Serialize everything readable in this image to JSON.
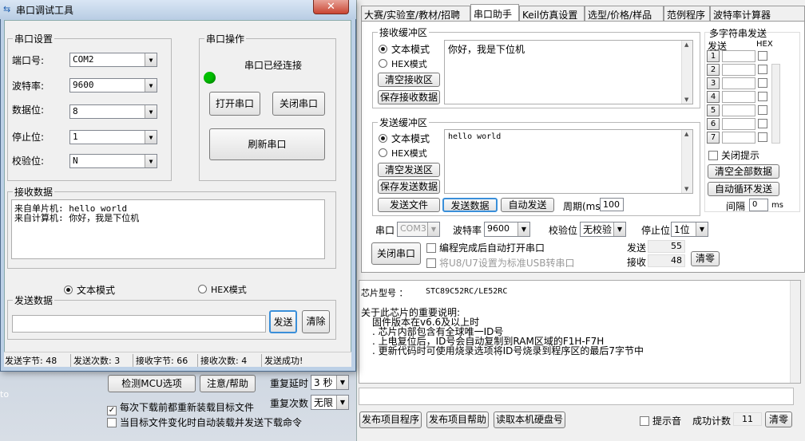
{
  "stc": {
    "tabs": [
      "大赛/实验室/教材/招聘",
      "串口助手",
      "Keil仿真设置",
      "选型/价格/样品",
      "范例程序",
      "波特率计算器"
    ],
    "recv_group": "接收缓冲区",
    "recv_text_mode": "文本模式",
    "recv_hex_mode": "HEX模式",
    "recv_clear": "清空接收区",
    "recv_save": "保存接收数据",
    "recv_content": "你好，我是下位机",
    "send_group": "发送缓冲区",
    "send_text_mode": "文本模式",
    "send_hex_mode": "HEX模式",
    "send_clear": "清空发送区",
    "send_save": "保存发送数据",
    "send_content": "hello world",
    "send_file": "发送文件",
    "send_data": "发送数据",
    "auto_send": "自动发送",
    "period_label": "周期(ms)",
    "period_value": "100",
    "multi_title": "多字符串发送",
    "multi_send": "发送",
    "multi_hex": "HEX",
    "multi_rows": [
      "1",
      "2",
      "3",
      "4",
      "5",
      "6",
      "7"
    ],
    "close_tip": "关闭提示",
    "clear_all": "清空全部数据",
    "auto_loop": "自动循环发送",
    "interval_label": "间隔",
    "interval_value": "0",
    "interval_unit": "ms",
    "port_label": "串口",
    "port_value": "COM3",
    "baud_label": "波特率",
    "baud_value": "9600",
    "parity_label": "校验位",
    "parity_value": "无校验",
    "stop_label": "停止位",
    "stop_value": "1位",
    "close_port": "关闭串口",
    "auto_open": "编程完成后自动打开串口",
    "usb_option": "将U8/U7设置为标准USB转串口",
    "sent_label": "发送",
    "sent_value": "55",
    "recv_label": "接收",
    "recv_value": "48",
    "clear_counts": "清零",
    "chip_label": "芯片型号 ：",
    "chip_value": "STC89C52RC/LE52RC",
    "info_title": "关于此芯片的重要说明:",
    "info_lines": [
      "固件版本在v6.6及以上时",
      "芯片内部包含有全球唯一ID号",
      "上电复位后，ID号会自动复制到RAM区域的F1H-F7H",
      "更新代码时可使用烧录选项将ID号烧录到程序区的最后7字节中"
    ],
    "detect_mcu": "检测MCU选项",
    "help": "注意/帮助",
    "delay_label": "重复延时",
    "delay_value": "3 秒",
    "count_label": "重复次数",
    "count_value": "无限",
    "reload_each": "每次下载前都重新装载目标文件",
    "reload_change": "当目标文件变化时自动装载并发送下载命令",
    "publish_prog": "发布项目程序",
    "publish_help": "发布项目帮助",
    "read_disk": "读取本机硬盘号",
    "beep": "提示音",
    "success_label": "成功计数",
    "success_value": "11",
    "success_clear": "清零"
  },
  "dlg": {
    "title": "串口调试工具",
    "settings_group": "串口设置",
    "port_label": "端口号:",
    "port_value": "COM2",
    "baud_label": "波特率:",
    "baud_value": "9600",
    "data_label": "数据位:",
    "data_value": "8",
    "stop_label": "停止位:",
    "stop_value": "1",
    "parity_label": "校验位:",
    "parity_value": "N",
    "ops_group": "串口操作",
    "status": "串口已经连接",
    "status_color": "#00c000",
    "open_btn": "打开串口",
    "close_btn": "关闭串口",
    "refresh_btn": "刷新串口",
    "recv_group": "接收数据",
    "recv_line1": "来自单片机: hello world",
    "recv_line2": "来自计算机: 你好，我是下位机",
    "text_mode": "文本模式",
    "hex_mode": "HEX模式",
    "send_group": "发送数据",
    "send_btn": "发送",
    "clear_btn": "清除",
    "status_bar": [
      "发送字节: 48",
      "发送次数: 3",
      "接收字节: 66",
      "接收次数: 4",
      "发送成功!"
    ],
    "desktop_text": "to"
  }
}
